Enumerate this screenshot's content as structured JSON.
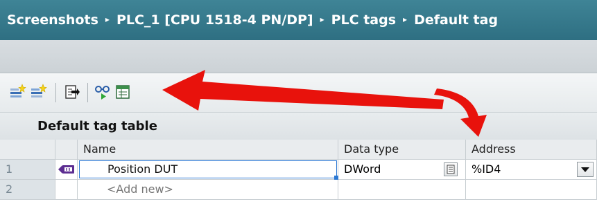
{
  "breadcrumb": {
    "items": [
      "Screenshots",
      "PLC_1 [CPU 1518-4 PN/DP]",
      "PLC tags",
      "Default tag"
    ],
    "separator": "▸"
  },
  "toolbar": {
    "icons": [
      "add-row-icon",
      "insert-row-icon",
      "export-icon",
      "monitor-icon",
      "monitor-all-icon"
    ]
  },
  "table": {
    "title": "Default tag table",
    "columns": [
      "Name",
      "Data type",
      "Address"
    ],
    "rows": [
      {
        "num": "1",
        "name": "Position DUT",
        "data_type": "DWord",
        "address": "%ID4"
      },
      {
        "num": "2",
        "name": "<Add new>",
        "data_type": "",
        "address": ""
      }
    ]
  },
  "colors": {
    "titlebar": "#2e6f82",
    "selection_border": "#2b78d3",
    "annotation_arrow": "#e8120c",
    "tag_icon": "#5c2d91"
  }
}
